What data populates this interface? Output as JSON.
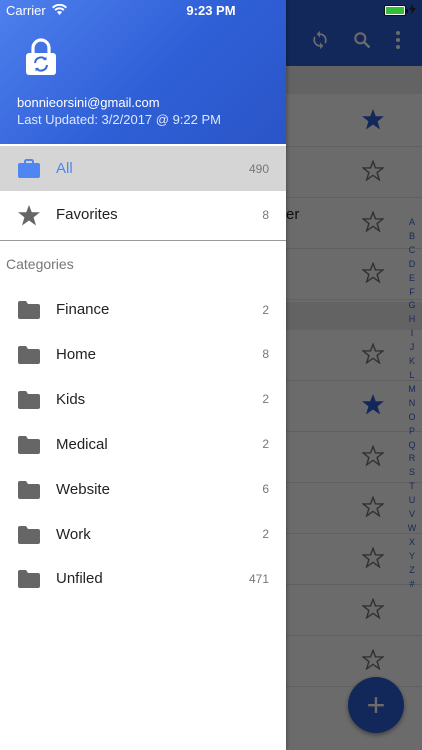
{
  "status_bar": {
    "carrier": "Carrier",
    "time": "9:23 PM"
  },
  "drawer": {
    "email": "bonnieorsini@gmail.com",
    "last_updated": "Last Updated: 3/2/2017 @ 9:22 PM",
    "nav": [
      {
        "label": "All",
        "count": "490",
        "icon": "briefcase-icon"
      },
      {
        "label": "Favorites",
        "count": "8",
        "icon": "star-icon"
      }
    ],
    "categories_label": "Categories",
    "categories": [
      {
        "label": "Finance",
        "count": "2"
      },
      {
        "label": "Home",
        "count": "8"
      },
      {
        "label": "Kids",
        "count": "2"
      },
      {
        "label": "Medical",
        "count": "2"
      },
      {
        "label": "Website",
        "count": "6"
      },
      {
        "label": "Work",
        "count": "2"
      },
      {
        "label": "Unfiled",
        "count": "471"
      }
    ]
  },
  "main": {
    "partial_text": "er",
    "index_letters": [
      "A",
      "B",
      "C",
      "D",
      "E",
      "F",
      "G",
      "H",
      "I",
      "J",
      "K",
      "L",
      "M",
      "N",
      "O",
      "P",
      "Q",
      "R",
      "S",
      "T",
      "U",
      "V",
      "W",
      "X",
      "Y",
      "Z",
      "#"
    ],
    "rows": [
      {
        "starred": true
      },
      {
        "starred": false
      },
      {
        "starred": false
      },
      {
        "starred": false
      },
      {
        "starred": false
      },
      {
        "starred": true
      },
      {
        "starred": false
      },
      {
        "starred": false
      },
      {
        "starred": false
      },
      {
        "starred": false
      },
      {
        "starred": false
      }
    ],
    "fab_label": "+"
  },
  "colors": {
    "accent": "#2f5fd6",
    "active_label": "#4f86f1",
    "icon_gray": "#666666"
  }
}
